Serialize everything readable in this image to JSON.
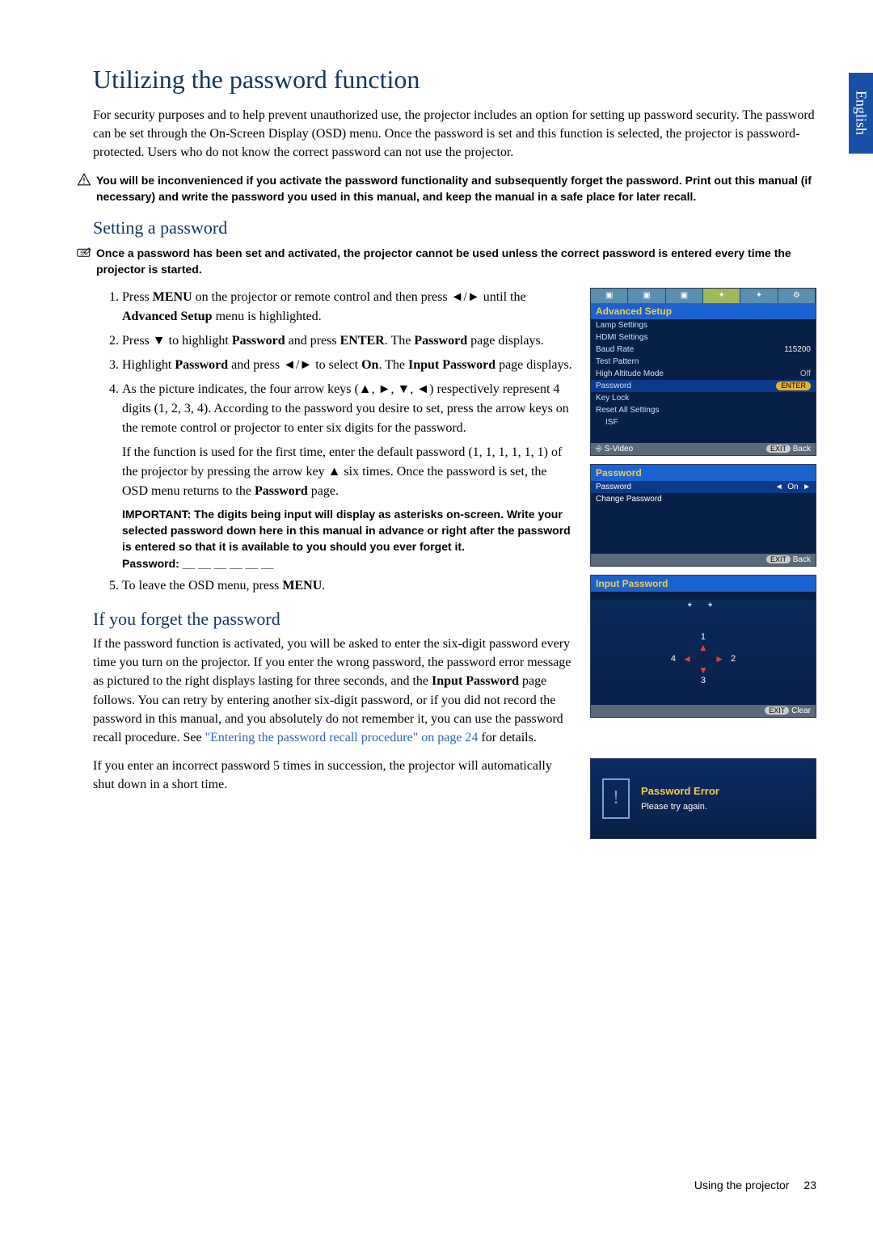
{
  "side_tab": "English",
  "h1": "Utilizing the password function",
  "intro": "For security purposes and to help prevent unauthorized use, the projector includes an option for setting up password security. The password can be set through the On-Screen Display (OSD) menu. Once the password is set and this function is selected, the projector is password-protected. Users who do not know the correct password can not use the projector.",
  "warn": "You will be inconvenienced if you activate the password functionality and subsequently forget the password. Print out this manual (if necessary) and write the password you used in this manual, and keep the manual in a safe place for later recall.",
  "h2a": "Setting a password",
  "note": "Once a password has been set and activated, the projector cannot be used unless the correct password is entered every time the projector is started.",
  "steps": {
    "s1a": "Press ",
    "s1_menu": "MENU",
    "s1b": " on the projector or remote control and then press ◄/► until the ",
    "s1_adv": "Advanced Setup",
    "s1c": " menu is highlighted.",
    "s2a": "Press ▼ to highlight ",
    "s2_pw": "Password",
    "s2b": " and press ",
    "s2_enter": "ENTER",
    "s2c": ". The ",
    "s2_pw2": "Password",
    "s2d": " page displays.",
    "s3a": "Highlight ",
    "s3_pw": "Password",
    "s3b": " and press ◄/► to select ",
    "s3_on": "On",
    "s3c": ". The ",
    "s3_ip": "Input Password",
    "s3d": " page displays.",
    "s4a": "As the picture indicates, the four arrow keys (▲, ►, ▼, ◄) respectively represent 4 digits (1, 2, 3, 4). According to the password you desire to set, press the arrow keys on the remote control or projector to enter six digits for the password.",
    "s4b": "If the function is used for the first time, enter the default password (1, 1, 1, 1, 1, 1) of the projector by pressing the arrow key ▲ six times. Once the password is set, the OSD menu returns to the ",
    "s4_pw": "Password",
    "s4c": " page.",
    "s4_imp": "IMPORTANT: The digits being input will display as asterisks on-screen. Write your selected password down here in this manual in advance or right after the password is entered so that it is available to you should you ever forget it.",
    "s4_pwline": "Password: __ __ __ __ __ __",
    "s5a": "To leave the OSD menu, press ",
    "s5_menu": "MENU",
    "s5b": "."
  },
  "h2b": "If you forget the password",
  "forget_a": "If the password function is activated, you will be asked to enter the six-digit password every time you turn on the projector. If you enter the wrong password, the password error message as pictured to the right displays lasting for three seconds, and the ",
  "forget_ip": "Input Password",
  "forget_b": " page follows. You can retry by entering another six-digit password, or if you did not record the password in this manual, and you absolutely do not remember it, you can use the password recall procedure. See ",
  "forget_link": "\"Entering the password recall procedure\" on page 24",
  "forget_c": " for details.",
  "forget2": "If you enter an incorrect password 5 times in succession, the projector will automatically shut down in a short time.",
  "osd1": {
    "title": "Advanced Setup",
    "items": [
      {
        "label": "Lamp Settings",
        "val": ""
      },
      {
        "label": "HDMI Settings",
        "val": ""
      },
      {
        "label": "Baud Rate",
        "val": "115200"
      },
      {
        "label": "Test Pattern",
        "val": ""
      },
      {
        "label": "High Altitude Mode",
        "val": "Off"
      },
      {
        "label": "Password",
        "val": "ENTER",
        "hl": true
      },
      {
        "label": "Key Lock",
        "val": ""
      },
      {
        "label": "Reset All Settings",
        "val": ""
      },
      {
        "label": "ISF",
        "val": ""
      }
    ],
    "footer_l": "S-Video",
    "footer_r": "Back",
    "exit": "EXIT"
  },
  "osd2": {
    "title": "Password",
    "row1": {
      "label": "Password",
      "val": "On"
    },
    "row2": "Change Password",
    "footer_r": "Back",
    "exit": "EXIT"
  },
  "osd3": {
    "title": "Input Password",
    "stars": "* *",
    "d1": "1",
    "d2": "2",
    "d3": "3",
    "d4": "4",
    "exit": "EXIT",
    "clear": "Clear"
  },
  "err": {
    "title": "Password Error",
    "sub": "Please try again."
  },
  "footer": {
    "label": "Using the projector",
    "page": "23"
  }
}
